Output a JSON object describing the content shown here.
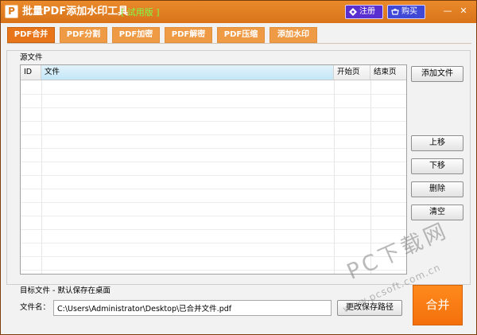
{
  "app": {
    "icon_letter": "P",
    "title": "批量PDF添加水印工具",
    "badge": "[ 试用版 ]"
  },
  "titlebar": {
    "register_label": "注册",
    "buy_label": "购买",
    "minimize": "—",
    "close": "✕"
  },
  "tabs": [
    {
      "label": "PDF合并",
      "active": true
    },
    {
      "label": "PDF分割",
      "active": false
    },
    {
      "label": "PDF加密",
      "active": false
    },
    {
      "label": "PDF解密",
      "active": false
    },
    {
      "label": "PDF压缩",
      "active": false
    },
    {
      "label": "添加水印",
      "active": false
    }
  ],
  "source": {
    "group_label": "源文件",
    "columns": [
      "ID",
      "文件",
      "开始页",
      "结束页"
    ]
  },
  "side_buttons": {
    "add_file": "添加文件",
    "move_up": "上移",
    "move_down": "下移",
    "delete": "删除",
    "clear": "清空"
  },
  "target": {
    "label": "目标文件 - 默认保存在桌面",
    "file_name_label": "文件名：",
    "file_name_value": "C:\\Users\\Administrator\\Desktop\\已合并文件.pdf",
    "change_path_label": "更改保存路径",
    "merge_label": "合并"
  },
  "watermark": {
    "text": "PC下载网",
    "url": "www.pcsoft.com.cn"
  },
  "colors": {
    "accent": "#e8751a",
    "tab": "#ef9a45",
    "register": "#5a2fd0",
    "buy": "#3f49d6",
    "badge": "#7dff4a"
  }
}
